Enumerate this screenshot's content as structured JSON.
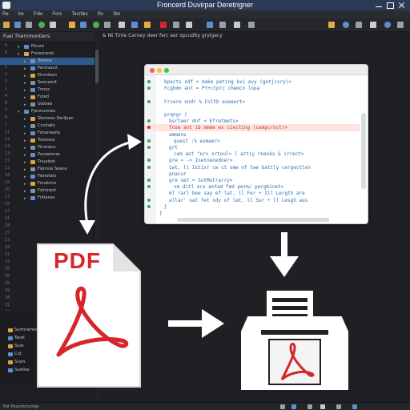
{
  "window": {
    "title": "Froncerd Duvirpar Deretrigner",
    "controls": [
      "minimize-icon",
      "maximize-icon",
      "close-icon"
    ]
  },
  "menu": [
    "Re",
    "Ire",
    "Frile",
    "Fors",
    "Tecrtiks",
    "Rs",
    "Ste"
  ],
  "toolbar": {
    "icons": [
      "folder-icon",
      "save-icon",
      "play-icon",
      "bug-icon",
      "search-icon",
      "pdf-icon",
      "settings-icon",
      "help-icon",
      "user-icon",
      "info-icon",
      "globe-icon",
      "grid-icon"
    ]
  },
  "left_panel": {
    "title": "Fuei Thernmontiers",
    "gutter": [
      "6",
      "8",
      "1",
      "1",
      "2",
      "3",
      "1",
      "4",
      "8",
      "7",
      "8",
      "7",
      "11",
      "12",
      "13",
      "13",
      "15",
      "11",
      "16",
      "15",
      "20",
      "13",
      "15",
      "17",
      "21",
      "18",
      "27",
      "23",
      "29",
      "31",
      "33",
      "35",
      "35",
      "35",
      "39",
      "38",
      "31",
      "38",
      "42",
      "43"
    ],
    "tree": [
      {
        "label": "Plnunt",
        "depth": 1
      },
      {
        "label": "Fnnesrunet",
        "depth": 1
      },
      {
        "label": "Tonena",
        "depth": 2,
        "selected": true
      },
      {
        "label": "Persnaunt",
        "depth": 2
      },
      {
        "label": "Etrsnteun",
        "depth": 2
      },
      {
        "label": "Sennamit",
        "depth": 2
      },
      {
        "label": "Tnnos",
        "depth": 2
      },
      {
        "label": "Futed",
        "depth": 2
      },
      {
        "label": "Ustlees",
        "depth": 2
      },
      {
        "label": "Fpronurntes",
        "depth": 1
      },
      {
        "label": "Stenmes Derilpan",
        "depth": 2
      },
      {
        "label": "Ccnlnets",
        "depth": 2
      },
      {
        "label": "Fonanwaits",
        "depth": 2
      },
      {
        "label": "Trsoness",
        "depth": 2
      },
      {
        "label": "Ptconecs",
        "depth": 2
      },
      {
        "label": "Pucewnnes",
        "depth": 2
      },
      {
        "label": "Tnuatest",
        "depth": 2
      },
      {
        "label": "Fiannoe Seane",
        "depth": 2
      },
      {
        "label": "Faerotats",
        "depth": 2
      },
      {
        "label": "Fonatrins",
        "depth": 2
      },
      {
        "label": "Fslmnent",
        "depth": 2
      },
      {
        "label": "Fntlanes",
        "depth": 2
      }
    ],
    "bottom_tree": [
      "Surmrames",
      "Tacet",
      "Suss",
      "Cut",
      "Scars",
      "Suetlas"
    ]
  },
  "editor": {
    "path": "& Nt Tinte Carney deer ferc aer opcudity grylgacy"
  },
  "code": {
    "lines": [
      {
        "text": "bpects  sdf  <  make  peting  kxi  avy  (getjcsry)>",
        "indent": 1,
        "color": "#2c6fb8"
      },
      {
        "text": "Fcghmn  ant  =  Pt+ctprc  chemcn  lopa",
        "indent": 1,
        "color": "#2c6fb8"
      },
      {
        "text": "",
        "indent": 0,
        "color": "#2c6fb8"
      },
      {
        "text": "Frcere  ondr  %   Fnltb  exeeert>",
        "indent": 1,
        "color": "#2c6fb8"
      },
      {
        "text": "",
        "indent": 0,
        "color": "#2c6fb8"
      },
      {
        "text": "prqngr  (",
        "indent": 1,
        "color": "#2c6fb8"
      },
      {
        "text": "bsrteer  dnf   <   Efretmets>",
        "indent": 2,
        "color": "#2c6fb8"
      },
      {
        "text": "fnse  ant  ib  mmme  ex  ciecting  (cempcrnct)>",
        "indent": 2,
        "color": "#c0392b",
        "hl": true
      },
      {
        "text": "ammens",
        "indent": 2,
        "color": "#2c6fb8"
      },
      {
        "text": "quest  :%  exmeer>",
        "indent": 3,
        "color": "#2c6fb8"
      },
      {
        "text": "grt",
        "indent": 2,
        "color": "#2c6fb8"
      },
      {
        "text": "cem  ast  \"erv  ortoul>  l  artiy  rnenks  &  irrect>",
        "indent": 3,
        "color": "#2c6fb8"
      },
      {
        "text": "pre  =  ->   Inetnenedner>",
        "indent": 2,
        "color": "#2c6fb8"
      },
      {
        "text": "iwt.   ll   Ixtixr  cw  ct  ome  of  twe  battly  cergectlen",
        "indent": 2,
        "color": "#2c6fb8"
      },
      {
        "text": "pnacur",
        "indent": 2,
        "color": "#2c6fb8"
      },
      {
        "text": "gre  set  =  SutMutrarry>",
        "indent": 2,
        "color": "#2c6fb8"
      },
      {
        "text": "vm  ditl  ecs  entad  fmd  pe+m/  pergbinet>",
        "indent": 3,
        "color": "#2c6fb8"
      },
      {
        "text": "ml  rarl  bee  say  ef  lat,  ll  Fer  +  Ill  Lergth  are",
        "indent": 2,
        "color": "#2c6fb8"
      },
      {
        "text": "allar'  uat  fet  sdy  of  lat,  ll  Sur  +  ll  Lesgh  aus",
        "indent": 2,
        "color": "#2c6fb8"
      },
      {
        "text": "}",
        "indent": 1,
        "color": "#2c6fb8"
      },
      {
        "text": "}",
        "indent": 0,
        "color": "#2c6fb8"
      }
    ]
  },
  "pdf": {
    "label": "PDF",
    "accent": "#d6262a"
  },
  "statusbar": {
    "text": "Fpt  Poucmcrunigs"
  },
  "colors": {
    "accent_blue": "#2f5a8c",
    "pdf_red": "#d6262a",
    "code_blue": "#2c6fb8"
  }
}
